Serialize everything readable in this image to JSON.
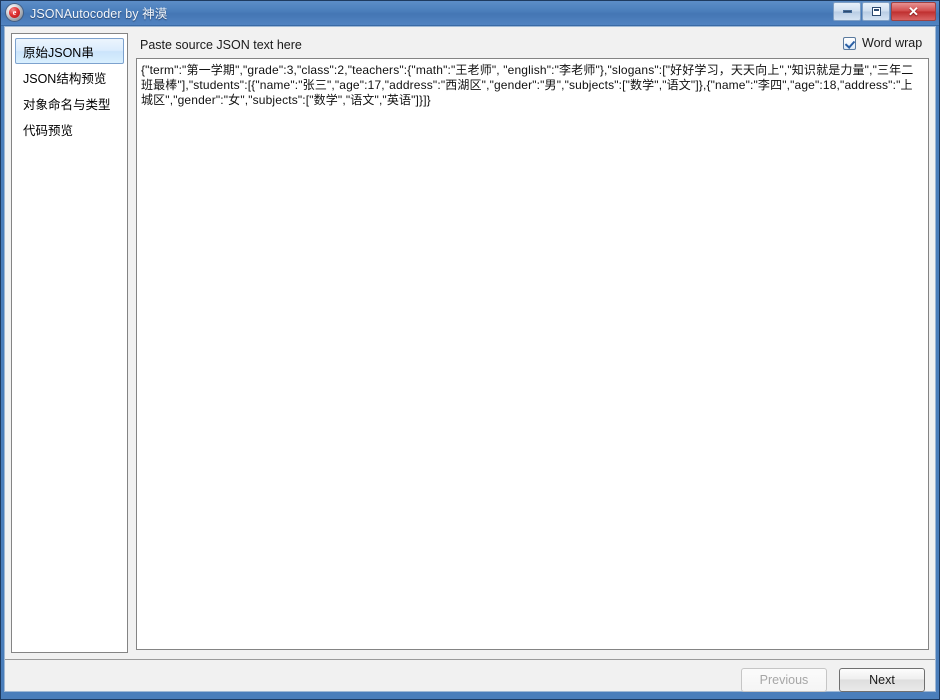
{
  "window": {
    "title": "JSONAutocoder by 神漠",
    "icon": "app-logo-icon",
    "minimize_label": "–",
    "maximize_label": "□",
    "close_label": "✕"
  },
  "sidebar": {
    "items": [
      {
        "label": "原始JSON串",
        "selected": true
      },
      {
        "label": "JSON结构预览",
        "selected": false
      },
      {
        "label": "对象命名与类型",
        "selected": false
      },
      {
        "label": "代码预览",
        "selected": false
      }
    ]
  },
  "main": {
    "header_title": "Paste source JSON text here",
    "word_wrap": {
      "label": "Word wrap",
      "checked": true
    },
    "editor": {
      "value": "{\"term\":\"第一学期\",\"grade\":3,\"class\":2,\"teachers\":{\"math\":\"王老师\", \"english\":\"李老师\"},\"slogans\":[\"好好学习，天天向上\",\"知识就是力量\",\"三年二班最棒\"],\"students\":[{\"name\":\"张三\",\"age\":17,\"address\":\"西湖区\",\"gender\":\"男\",\"subjects\":[\"数学\",\"语文\"]},{\"name\":\"李四\",\"age\":18,\"address\":\"上城区\",\"gender\":\"女\",\"subjects\":[\"数学\",\"语文\",\"英语\"]}]}",
      "placeholder": "Paste source JSON text here"
    }
  },
  "footer": {
    "previous_label": "Previous",
    "next_label": "Next",
    "previous_enabled": false,
    "next_enabled": true
  },
  "colors": {
    "titlebar": "#4a7ebb",
    "frame": "#4a7ebb",
    "selection": "#cbe4fb",
    "selection_border": "#7da2ce",
    "close_button": "#d14b4b",
    "panel_bg": "#f1f1f1",
    "editor_bg": "#ffffff"
  }
}
